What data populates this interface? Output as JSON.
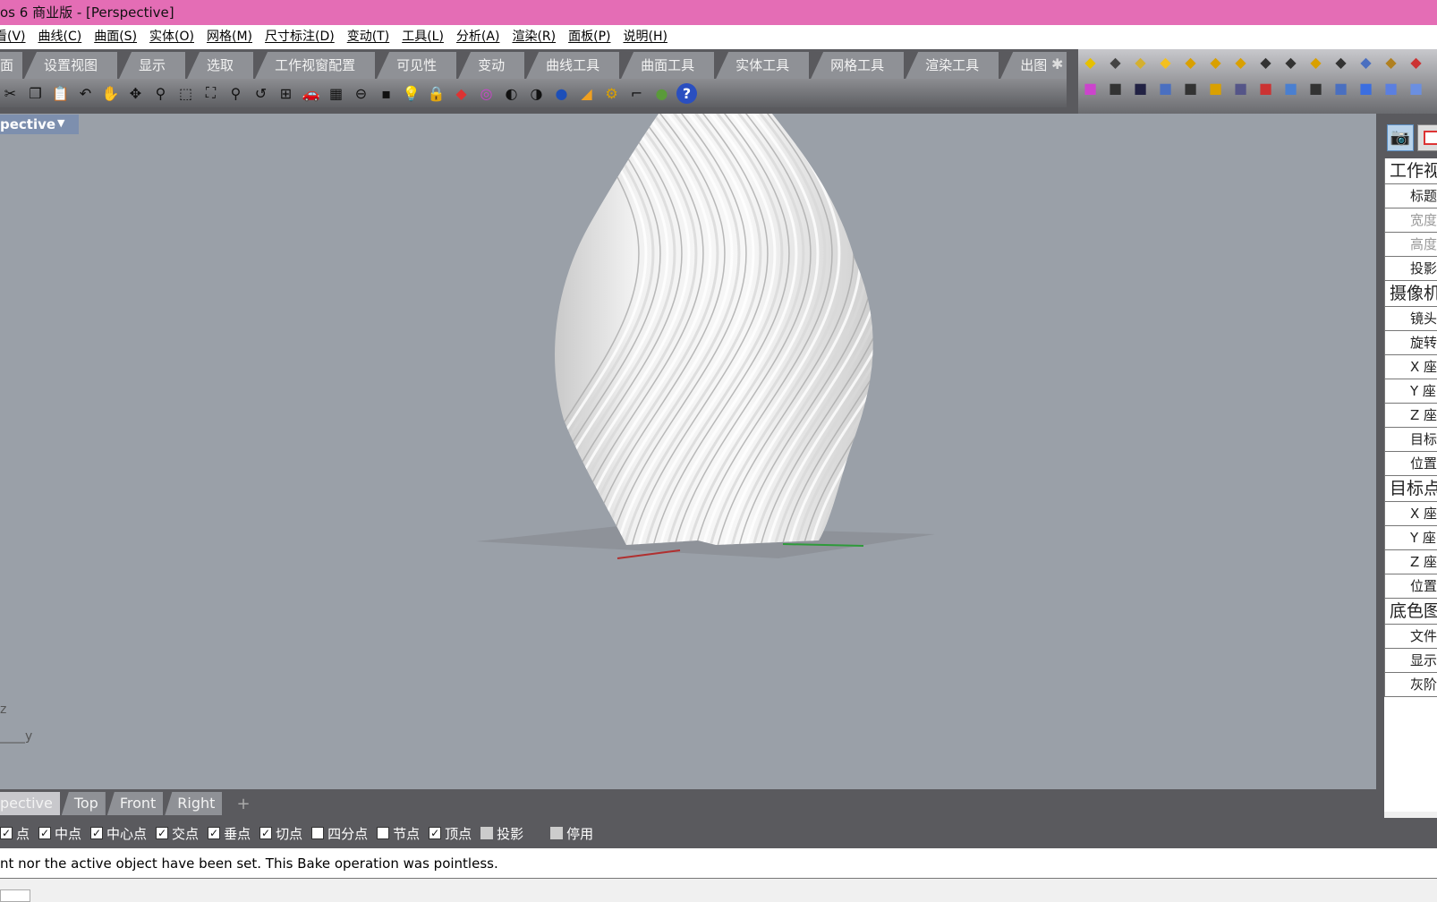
{
  "window": {
    "title": "os 6 商业版 - [Perspective]",
    "title_bar_color": "#e46db5"
  },
  "menu": [
    "看(V)",
    "曲线(C)",
    "曲面(S)",
    "实体(O)",
    "网格(M)",
    "尺寸标注(D)",
    "变动(T)",
    "工具(L)",
    "分析(A)",
    "渲染(R)",
    "面板(P)",
    "说明(H)"
  ],
  "toolbar_tabs": [
    "面",
    "设置视图",
    "显示",
    "选取",
    "工作视窗配置",
    "可见性",
    "变动",
    "曲线工具",
    "曲面工具",
    "实体工具",
    "网格工具",
    "渲染工具",
    "出图"
  ],
  "toolbar_icons": [
    "cut-icon",
    "copy-icon",
    "paste-icon",
    "undo-icon",
    "pan-hand-icon",
    "rotate-view-icon",
    "zoom-icon",
    "zoom-window-icon",
    "zoom-extents-icon",
    "zoom-selected-icon",
    "undo-view-icon",
    "four-viewports-icon",
    "car-icon",
    "named-view-icon",
    "cplane-icon",
    "points-icon",
    "light-icon",
    "lock-icon",
    "layer-icon",
    "color-wheel-icon",
    "wireframe-sphere-icon",
    "shaded-sphere-icon",
    "rendered-sphere-icon",
    "material-icon",
    "options-gear-icon",
    "snap-icon",
    "grasshopper-icon",
    "help-icon"
  ],
  "viewport": {
    "label": "pective",
    "axis_z": "z",
    "axis_y": "y",
    "background": "#9aa0a8"
  },
  "viewport_tabs": {
    "items": [
      "pective",
      "Top",
      "Front",
      "Right"
    ],
    "active": 0,
    "add": "+"
  },
  "properties_panel": {
    "rows": [
      {
        "text": "工作视",
        "type": "header"
      },
      {
        "text": "标题",
        "type": "item"
      },
      {
        "text": "宽度",
        "type": "disabled"
      },
      {
        "text": "高度",
        "type": "disabled"
      },
      {
        "text": "投影",
        "type": "item"
      },
      {
        "text": "摄像机",
        "type": "header"
      },
      {
        "text": "镜头",
        "type": "item"
      },
      {
        "text": "旋转",
        "type": "item"
      },
      {
        "text": "X 座",
        "type": "item"
      },
      {
        "text": "Y 座",
        "type": "item"
      },
      {
        "text": "Z 座",
        "type": "item"
      },
      {
        "text": "目标",
        "type": "item"
      },
      {
        "text": "位置",
        "type": "item"
      },
      {
        "text": "目标点",
        "type": "header"
      },
      {
        "text": "X 座",
        "type": "item"
      },
      {
        "text": "Y 座",
        "type": "item"
      },
      {
        "text": "Z 座",
        "type": "item"
      },
      {
        "text": "位置",
        "type": "item"
      },
      {
        "text": "底色图",
        "type": "header"
      },
      {
        "text": "文件",
        "type": "item"
      },
      {
        "text": "显示",
        "type": "item"
      },
      {
        "text": "灰阶",
        "type": "item"
      }
    ]
  },
  "osnap": [
    {
      "label": "点",
      "checked": true
    },
    {
      "label": "中点",
      "checked": true
    },
    {
      "label": "中心点",
      "checked": true
    },
    {
      "label": "交点",
      "checked": true
    },
    {
      "label": "垂点",
      "checked": true
    },
    {
      "label": "切点",
      "checked": true
    },
    {
      "label": "四分点",
      "checked": false
    },
    {
      "label": "节点",
      "checked": false
    },
    {
      "label": "顶点",
      "checked": true
    },
    {
      "label": "投影",
      "checked": false,
      "disabled": true
    },
    {
      "label": "停用",
      "checked": false,
      "disabled": true
    }
  ],
  "command": {
    "history": "nt nor the active object have been set. This Bake operation was pointless."
  }
}
